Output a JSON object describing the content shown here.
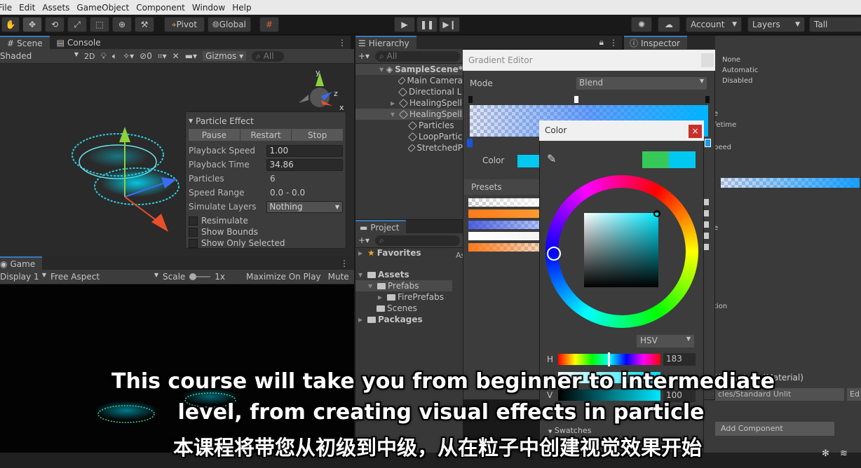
{
  "menu": [
    "File",
    "Edit",
    "Assets",
    "GameObject",
    "Component",
    "Window",
    "Help"
  ],
  "toolbar": {
    "pivot": "Pivot",
    "global": "Global",
    "account": "Account",
    "layers": "Layers",
    "layout": "Tall"
  },
  "scene": {
    "tab_scene": "Scene",
    "tab_console": "Console",
    "shading": "Shaded",
    "mode2d": "2D",
    "hidden_count": "0",
    "gizmos": "Gizmos",
    "search_placeholder": "All",
    "axis_y": "y",
    "axis_z": "z",
    "axis_x": "x"
  },
  "particle_effect": {
    "title": "Particle Effect",
    "pause": "Pause",
    "restart": "Restart",
    "stop": "Stop",
    "rows": [
      {
        "label": "Playback Speed",
        "value": "1.00"
      },
      {
        "label": "Playback Time",
        "value": "34.86"
      },
      {
        "label": "Particles",
        "value": "6"
      },
      {
        "label": "Speed Range",
        "value": "0.0 - 0.0"
      },
      {
        "label": "Simulate Layers",
        "value": "Nothing"
      }
    ],
    "checks": [
      "Resimulate",
      "Show Bounds",
      "Show Only Selected"
    ]
  },
  "game": {
    "tab": "Game",
    "display": "Display 1",
    "aspect": "Free Aspect",
    "scale_label": "Scale",
    "scale_value": "1x",
    "maximize": "Maximize On Play",
    "mute": "Mute"
  },
  "hierarchy": {
    "tab": "Hierarchy",
    "search_placeholder": "All",
    "items": [
      {
        "label": "SampleScene*",
        "indent": 0
      },
      {
        "label": "Main Camera",
        "indent": 1
      },
      {
        "label": "Directional L",
        "indent": 1
      },
      {
        "label": "HealingSpell",
        "indent": 1
      },
      {
        "label": "HealingSpell",
        "indent": 1
      },
      {
        "label": "Particles",
        "indent": 2
      },
      {
        "label": "LoopPartic",
        "indent": 2
      },
      {
        "label": "StretchedP",
        "indent": 2
      }
    ]
  },
  "project": {
    "tab": "Project",
    "favorites": "Favorites",
    "assets": "Assets",
    "prefabs": "Prefabs",
    "fire_prefabs": "FirePrefabs",
    "scenes": "Scenes",
    "packages": "Packages",
    "side_letter": "As"
  },
  "inspector": {
    "tab": "Inspector",
    "values": [
      "None",
      "Automatic",
      "Disabled"
    ],
    "frag1": "e",
    "frag2": "fetime",
    "frag3": "peed",
    "frag4": "e",
    "frag5": "tion",
    "material": "tle System (Material)",
    "shader": "cles/Standard Unlit",
    "edit": "Ed",
    "add_component": "Add Component"
  },
  "gradient_editor": {
    "title": "Gradient Editor",
    "mode_label": "Mode",
    "mode_value": "Blend",
    "color_label": "Color",
    "presets_label": "Presets"
  },
  "color_picker": {
    "title": "Color",
    "close": "×",
    "model": "HSV",
    "h_label": "H",
    "h_value": "183",
    "v_label": "V",
    "v_value": "100",
    "swatches": "Swatches",
    "current_color": "#00c8f0",
    "previous_color": "#37c85a"
  },
  "subtitles": {
    "line1": "This course will take you from beginner to intermediate",
    "line2": "level, from creating visual effects in particle",
    "line3": "本课程将带您从初级到中级，从在粒子中创建视觉效果开始"
  }
}
